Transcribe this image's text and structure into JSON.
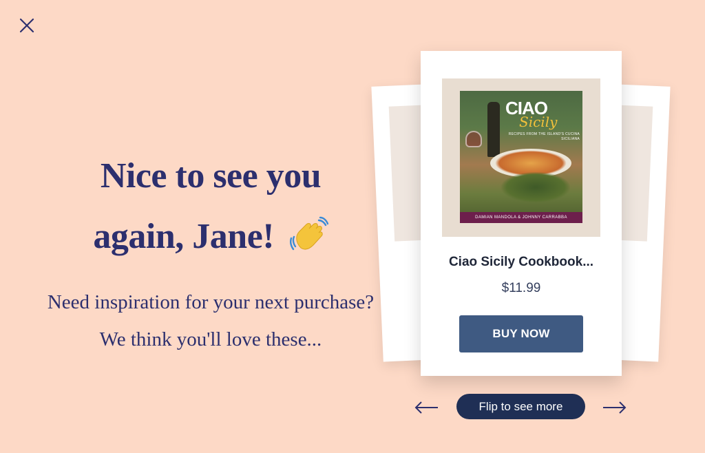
{
  "close": {
    "icon": "close-icon"
  },
  "greeting": {
    "headline_line1": "Nice to see you",
    "headline_line2": "again, Jane!",
    "wave_icon": "waving-hand-icon",
    "subtext_line1": "Need inspiration for your next purchase?",
    "subtext_line2": "We think you'll love these..."
  },
  "product": {
    "cover": {
      "title_main": "CIAO",
      "title_script": "Sicily",
      "tagline": "RECIPES FROM THE ISLAND'S CUCINA SICILIANA",
      "authors": "DAMIAN MANDOLA & JOHNNY CARRABBA"
    },
    "name": "Ciao Sicily Cookbook...",
    "price": "$11.99",
    "buy_label": "BUY NOW"
  },
  "carousel": {
    "prev_icon": "arrow-left-icon",
    "next_icon": "arrow-right-icon",
    "flip_label": "Flip to see more"
  },
  "colors": {
    "background": "#fdd9c6",
    "headline": "#2c2f6e",
    "buy_button": "#3f5a82",
    "flip_pill": "#1f2f55"
  }
}
